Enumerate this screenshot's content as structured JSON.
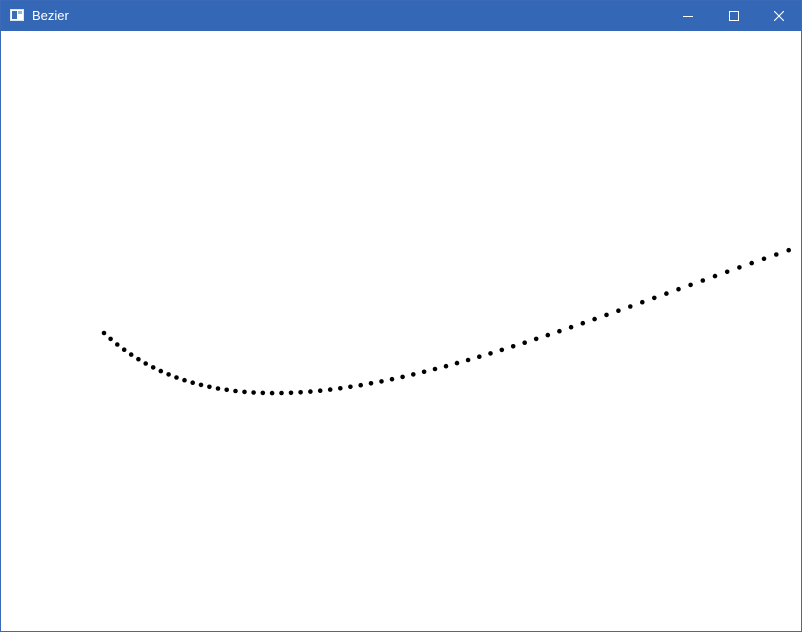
{
  "window": {
    "title": "Bezier",
    "accent_color": "#3468b6",
    "title_color": "#ffffff",
    "app_icon": "window-app-icon",
    "controls": [
      {
        "name": "minimize",
        "icon": "minimize-icon"
      },
      {
        "name": "maximize",
        "icon": "maximize-icon"
      },
      {
        "name": "close",
        "icon": "close-icon"
      }
    ]
  },
  "canvas": {
    "background": "#ffffff",
    "curve": {
      "type": "cubic-bezier",
      "point_color": "#000000",
      "point_count": 69
    }
  }
}
